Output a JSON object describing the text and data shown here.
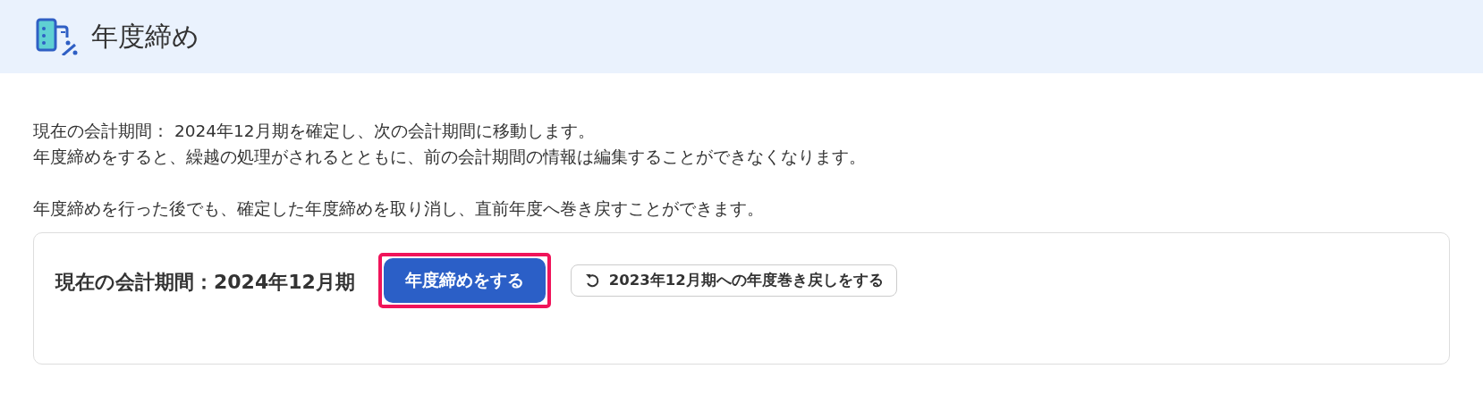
{
  "header": {
    "title": "年度締め"
  },
  "description": [
    "現在の会計期間： 2024年12月期を確定し、次の会計期間に移動します。",
    "年度締めをすると、繰越の処理がされるとともに、前の会計期間の情報は編集することができなくなります。"
  ],
  "note": "年度締めを行った後でも、確定した年度締めを取り消し、直前年度へ巻き戻すことができます。",
  "card": {
    "period_label": "現在の会計期間：2024年12月期",
    "buttons": [
      {
        "kind": "primary",
        "label": "年度締めをする",
        "highlighted": true
      },
      {
        "kind": "undo",
        "label": "2023年12月期への年度巻き戻しをする",
        "highlighted": false
      }
    ]
  }
}
